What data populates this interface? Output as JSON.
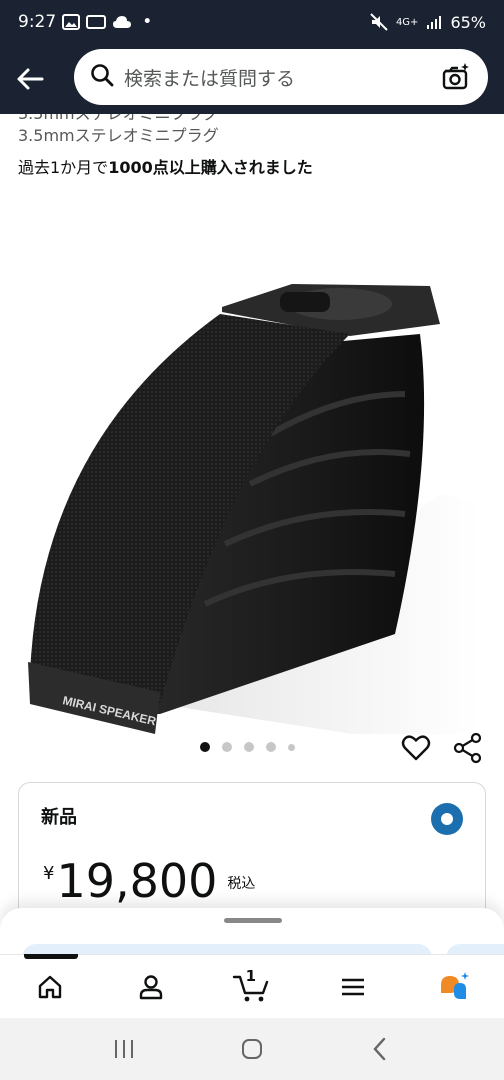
{
  "status_bar": {
    "time": "9:27",
    "dot": "•",
    "network": "4G+",
    "battery": "65%"
  },
  "header": {
    "search_placeholder": "検索または質問する"
  },
  "product": {
    "subtitle_clipped": "3.5mmステレオミニプラグ",
    "subtitle": "3.5mmステレオミニプラグ",
    "purchase_prefix": "過去1か月で",
    "purchase_bold": "1000点以上購入されました",
    "brand_label": "MIRAI SPEAKER",
    "image_count": 5
  },
  "buy_box": {
    "condition": "新品",
    "currency": "¥",
    "price": "19,800",
    "tax_label": "税込"
  },
  "bottom_nav": {
    "items": [
      "home-icon",
      "account-icon",
      "cart-icon",
      "menu-icon",
      "rufus-icon"
    ],
    "cart_count": "1"
  },
  "colors": {
    "header_bg": "#1b2332",
    "accent_blue": "#1c6fae",
    "rufus_orange": "#f08a24",
    "rufus_blue": "#1f8ce6"
  }
}
